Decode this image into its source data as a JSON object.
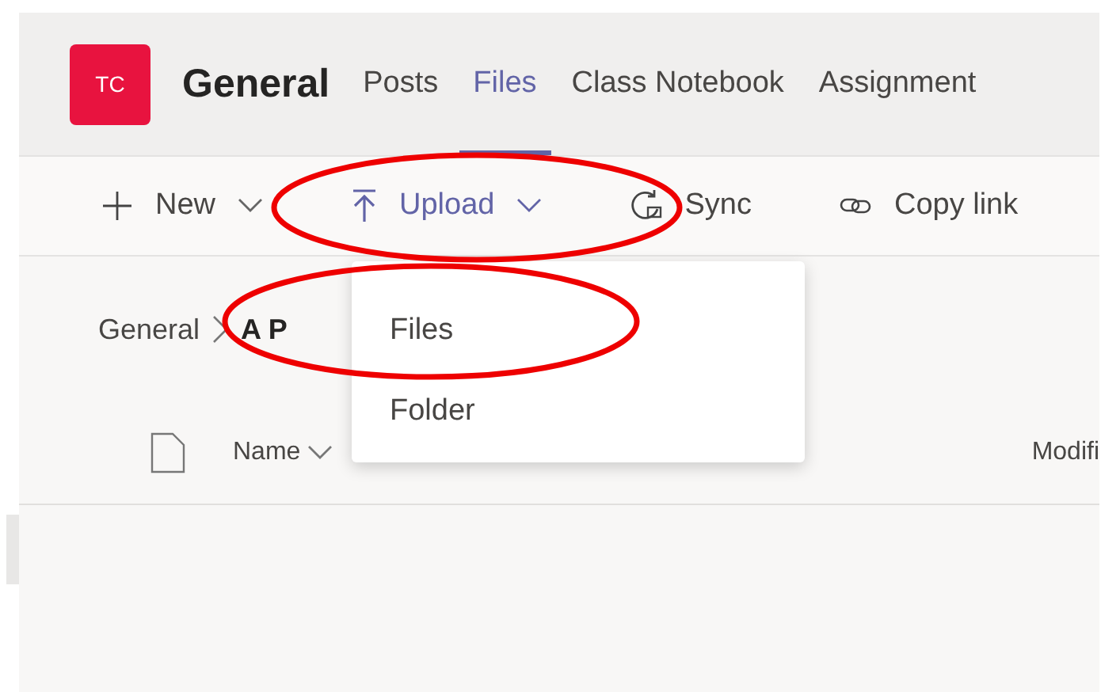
{
  "team": {
    "initials": "TC",
    "name": "General"
  },
  "tabs": [
    {
      "label": "Posts",
      "selected": false
    },
    {
      "label": "Files",
      "selected": true
    },
    {
      "label": "Class Notebook",
      "selected": false
    },
    {
      "label": "Assignment",
      "selected": false
    }
  ],
  "toolbar": [
    {
      "kind": "new",
      "label": "New",
      "expanded": false
    },
    {
      "kind": "upload",
      "label": "Upload",
      "expanded": true
    },
    {
      "kind": "sync",
      "label": "Sync",
      "expanded": false
    },
    {
      "kind": "copy_link",
      "label": "Copy link",
      "expanded": false
    }
  ],
  "breadcrumb": [
    "General",
    "A P"
  ],
  "upload_menu": {
    "items": [
      "Files",
      "Folder"
    ]
  },
  "columns": [
    {
      "kind": "sortable",
      "label": "Name"
    },
    {
      "kind": "plain",
      "label": "Modifi"
    }
  ]
}
